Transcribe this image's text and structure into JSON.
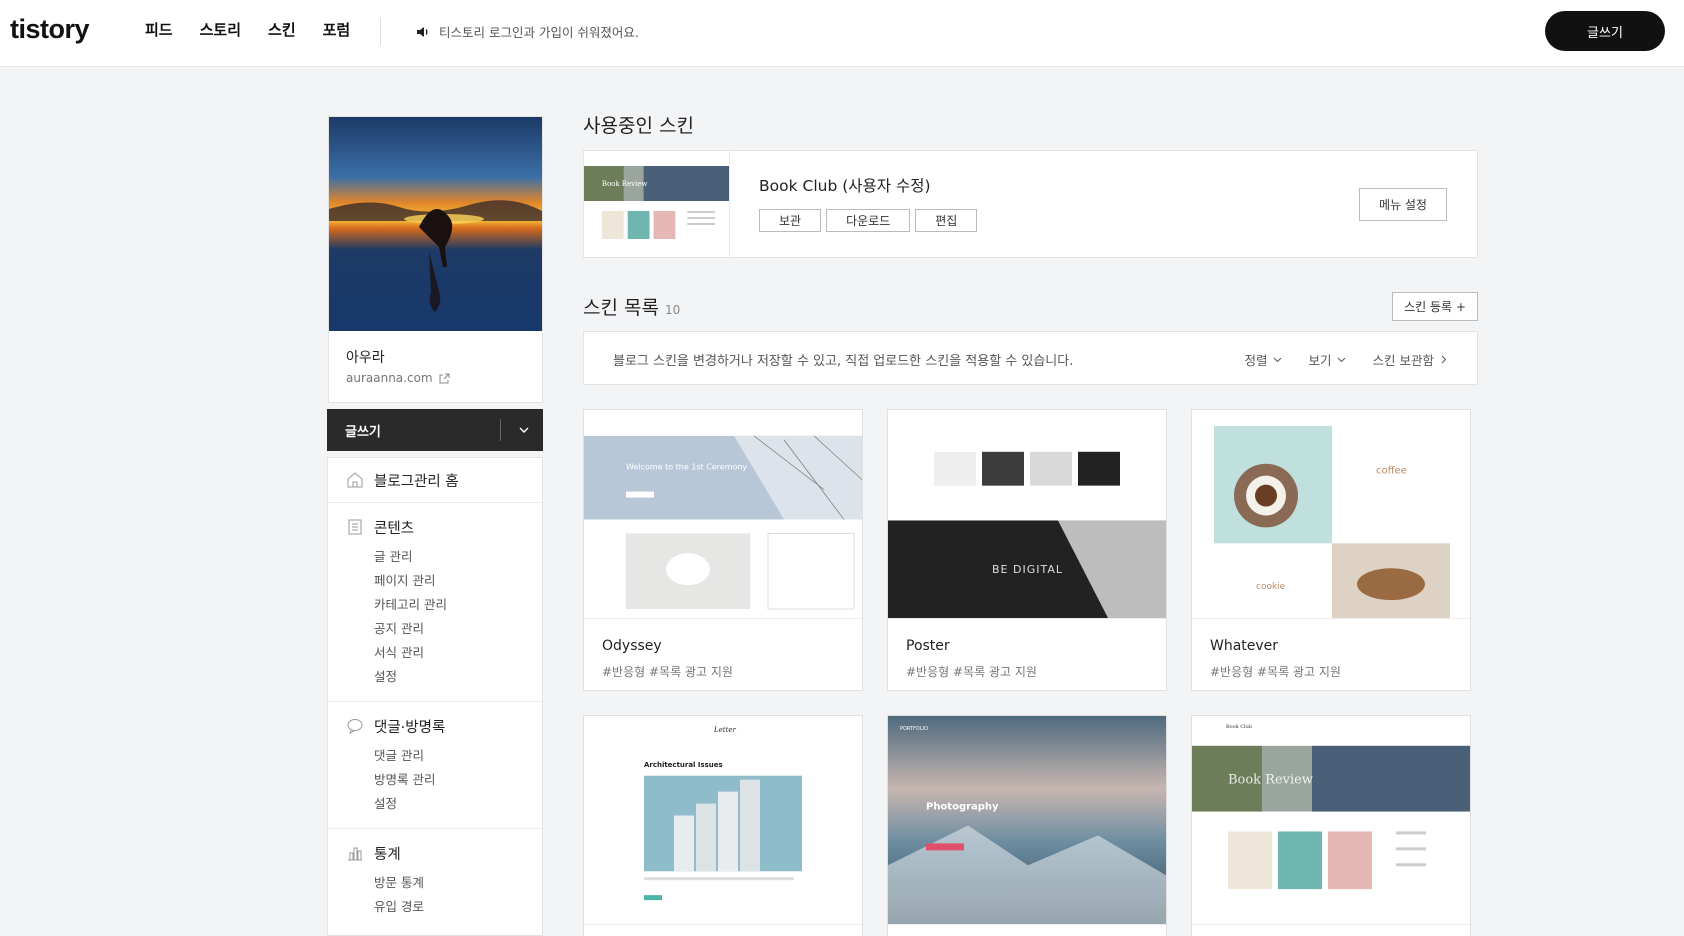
{
  "header": {
    "logo": "tistory",
    "nav": [
      "피드",
      "스토리",
      "스킨",
      "포럼"
    ],
    "notice": "티스토리 로그인과 가입이 쉬워졌어요.",
    "write_label": "글쓰기"
  },
  "profile": {
    "name": "아우라",
    "url": "auraanna.com"
  },
  "sidebar": {
    "write_label": "글쓰기",
    "sections": [
      {
        "title": "블로그관리 홈",
        "icon": "home-icon",
        "items": []
      },
      {
        "title": "콘텐츠",
        "icon": "document-icon",
        "items": [
          "글 관리",
          "페이지 관리",
          "카테고리 관리",
          "공지 관리",
          "서식 관리",
          "설정"
        ]
      },
      {
        "title": "댓글·방명록",
        "icon": "comment-icon",
        "items": [
          "댓글 관리",
          "방명록 관리",
          "설정"
        ]
      },
      {
        "title": "통계",
        "icon": "chart-icon",
        "items": [
          "방문 통계",
          "유입 경로"
        ]
      }
    ]
  },
  "current_skin": {
    "heading": "사용중인 스킨",
    "name": "Book Club (사용자 수정)",
    "buttons": [
      "보관",
      "다운로드",
      "편집"
    ],
    "menu_settings": "메뉴 설정",
    "thumb_text": "Book Review"
  },
  "skin_list": {
    "heading": "스킨 목록",
    "count": "10",
    "register": "스킨 등록 +",
    "description": "블로그 스킨을 변경하거나 저장할 수 있고, 직접 업로드한 스킨을 적용할 수 있습니다.",
    "controls": [
      "정렬",
      "보기",
      "스킨 보관함"
    ],
    "skins": [
      {
        "name": "Odyssey",
        "tags": "#반응형   #목록 광고 지원",
        "thumb_title": "Welcome to the 1st Ceremony"
      },
      {
        "name": "Poster",
        "tags": "#반응형   #목록 광고 지원",
        "thumb_title": "BE DIGITAL"
      },
      {
        "name": "Whatever",
        "tags": "#반응형   #목록 광고 지원",
        "thumb_title": "coffee"
      },
      {
        "name": "",
        "tags": "",
        "thumb_title": "Architectural Issues"
      },
      {
        "name": "",
        "tags": "",
        "thumb_title": "Photography"
      },
      {
        "name": "",
        "tags": "",
        "thumb_title": "Book Review"
      }
    ]
  },
  "colors": {
    "accent_dark": "#111111",
    "page_bg": "#f3f4f6"
  }
}
